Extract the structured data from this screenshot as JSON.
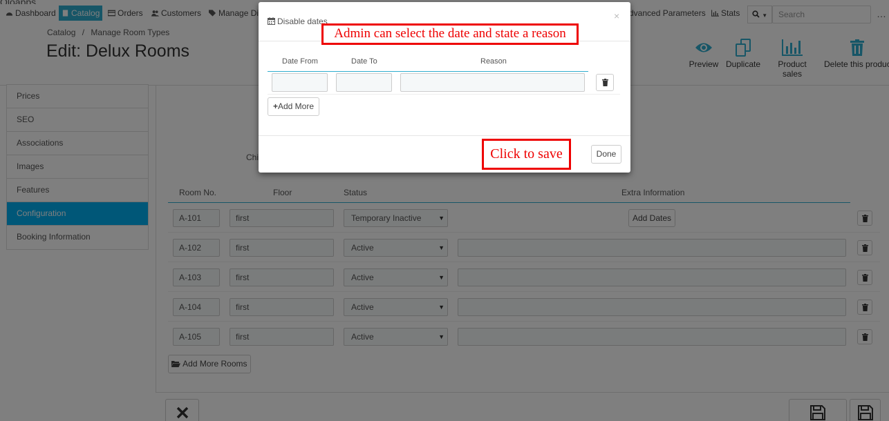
{
  "nav": {
    "logo_text": "Qloapps",
    "items": [
      {
        "label": "Dashboard",
        "icon": "dashboard-icon"
      },
      {
        "label": "Catalog",
        "icon": "book-icon",
        "active": true
      },
      {
        "label": "Orders",
        "icon": "credit-card-icon"
      },
      {
        "label": "Customers",
        "icon": "users-icon"
      },
      {
        "label": "Manage Dis",
        "icon": "tag-icon"
      },
      {
        "label": "dvanced Parameters",
        "icon": ""
      },
      {
        "label": "Stats",
        "icon": "bar-chart-icon"
      }
    ],
    "search_placeholder": "Search",
    "more": "…"
  },
  "header": {
    "breadcrumb": [
      "Catalog",
      "/",
      "Manage Room Types"
    ],
    "title": "Edit: Delux Rooms",
    "toolbar": [
      "Preview",
      "Duplicate",
      "Product sales",
      "Delete this produc"
    ]
  },
  "sidebar": [
    "Prices",
    "SEO",
    "Associations",
    "Images",
    "Features",
    "Configuration",
    "Booking Information"
  ],
  "sidebar_active": "Configuration",
  "rooms_table": {
    "headers": [
      "Room No.",
      "Floor",
      "Status",
      "Extra Information"
    ],
    "rows": [
      {
        "room": "A-101",
        "floor": "first",
        "status": "Temporary Inactive",
        "extra": "Add Dates"
      },
      {
        "room": "A-102",
        "floor": "first",
        "status": "Active",
        "extra": ""
      },
      {
        "room": "A-103",
        "floor": "first",
        "status": "Active",
        "extra": ""
      },
      {
        "room": "A-104",
        "floor": "first",
        "status": "Active",
        "extra": ""
      },
      {
        "room": "A-105",
        "floor": "first",
        "status": "Active",
        "extra": ""
      }
    ],
    "add_more_rooms": "Add More Rooms",
    "partial_label": "Chi"
  },
  "modal": {
    "title": "Disable dates",
    "close": "×",
    "headers": [
      "Date From",
      "Date To",
      "Reason"
    ],
    "add_more": "Add More",
    "done": "Done"
  },
  "annotations": {
    "top": "Admin can select the date and state a reason",
    "save": "Click to save"
  },
  "colors": {
    "accent": "#2eacce",
    "active_tab": "#00aff0",
    "annotation": "#e00000"
  }
}
